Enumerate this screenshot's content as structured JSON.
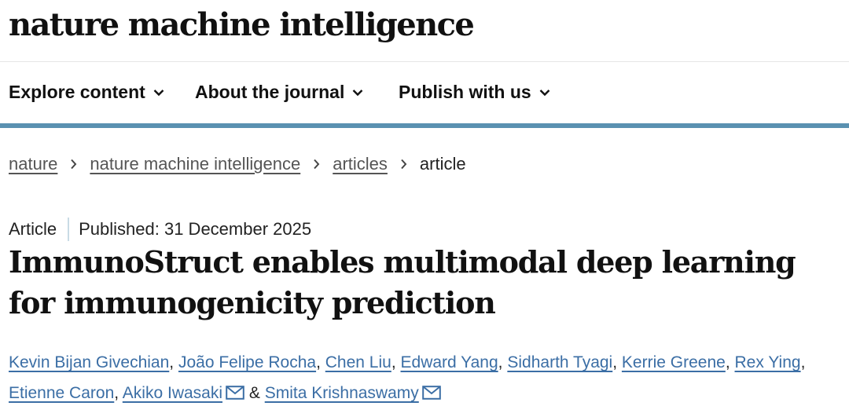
{
  "header": {
    "journal_name": "nature machine intelligence"
  },
  "nav": {
    "items": [
      {
        "label": "Explore content",
        "icon": "chevron-down-icon"
      },
      {
        "label": "About the journal",
        "icon": "chevron-down-icon"
      },
      {
        "label": "Publish with us",
        "icon": "chevron-down-icon"
      }
    ]
  },
  "breadcrumb": {
    "items": [
      "nature",
      "nature machine intelligence",
      "articles"
    ],
    "current": "article"
  },
  "article": {
    "type": "Article",
    "published": "Published: 31 December 2025",
    "title": "ImmunoStruct enables multimodal deep learning for immunogenicity prediction",
    "authors": [
      "Kevin Bijan Givechian",
      "João Felipe Rocha",
      "Chen Liu",
      "Edward Yang",
      "Sidharth Tyagi",
      "Kerrie Greene",
      "Rex Ying",
      "Etienne Caron",
      "Akiko Iwasaki",
      "Smita Krishnaswamy"
    ],
    "author_separator": ",",
    "conjunction": "&",
    "corresponding_icon": "mail-icon"
  },
  "colors": {
    "accent_rule": "#5a91b1",
    "link": "#3b6ea5",
    "divider": "#c9dbe5"
  }
}
